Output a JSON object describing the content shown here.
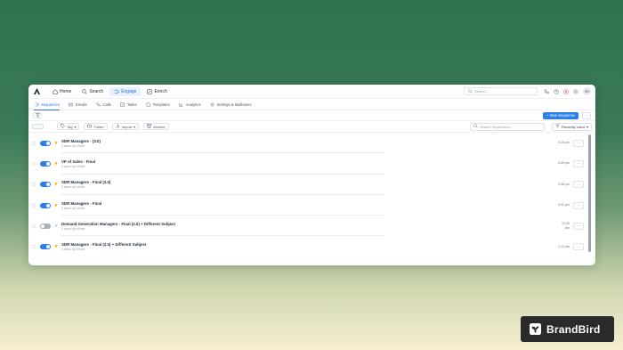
{
  "topnav": {
    "items": [
      {
        "label": "Home",
        "icon": "home-icon"
      },
      {
        "label": "Search",
        "icon": "search-icon"
      },
      {
        "label": "Engage",
        "icon": "engage-icon",
        "active": true
      },
      {
        "label": "Enrich",
        "icon": "enrich-icon"
      }
    ],
    "search_placeholder": "Search...",
    "avatar_initials": "SR"
  },
  "subnav": {
    "items": [
      {
        "label": "Sequences",
        "active": true
      },
      {
        "label": "Emails"
      },
      {
        "label": "Calls"
      },
      {
        "label": "Tasks"
      },
      {
        "label": "Templates"
      },
      {
        "label": "Analytics"
      },
      {
        "label": "Settings & Mailboxes"
      }
    ]
  },
  "actions": {
    "new_sequence_label": "+ New Sequence",
    "more_label": "···"
  },
  "toolbar": {
    "tag_label": "Tag",
    "folder_label": "Folder",
    "import_label": "Import",
    "archive_label": "Archive",
    "search_placeholder": "Search Sequences...",
    "sort_label": "Recently Used"
  },
  "sequences": [
    {
      "title": "SDR Managers - (3.0)",
      "subtitle": "3 steps by Infinite",
      "time": "3:16 pm",
      "enabled": true,
      "starred": true
    },
    {
      "title": "VP of Sales - Final",
      "subtitle": "3 steps by Infinite",
      "time": "3:49 pm",
      "enabled": true,
      "starred": true
    },
    {
      "title": "SDR Managers - Final (2.0)",
      "subtitle": "3 steps by Infinite",
      "time": "3:38 pm",
      "enabled": true,
      "starred": true
    },
    {
      "title": "SDR Managers - Final",
      "subtitle": "3 steps by Infinite",
      "time": "3:32 pm",
      "enabled": true,
      "starred": true
    },
    {
      "title": "Demand Generation Managers - Final (2.0) + Different Subject",
      "subtitle": "3 steps by Infinite",
      "time": "10:30\nam",
      "enabled": false,
      "starred": false
    },
    {
      "title": "SDR Managers - Final (2.0) + Different Subject",
      "subtitle": "3 steps by Infinite",
      "time": "1:13 am",
      "enabled": true,
      "starred": true
    }
  ],
  "brand": {
    "name": "BrandBird"
  },
  "colors": {
    "accent": "#2b7fe6",
    "star": "#f4b400"
  }
}
